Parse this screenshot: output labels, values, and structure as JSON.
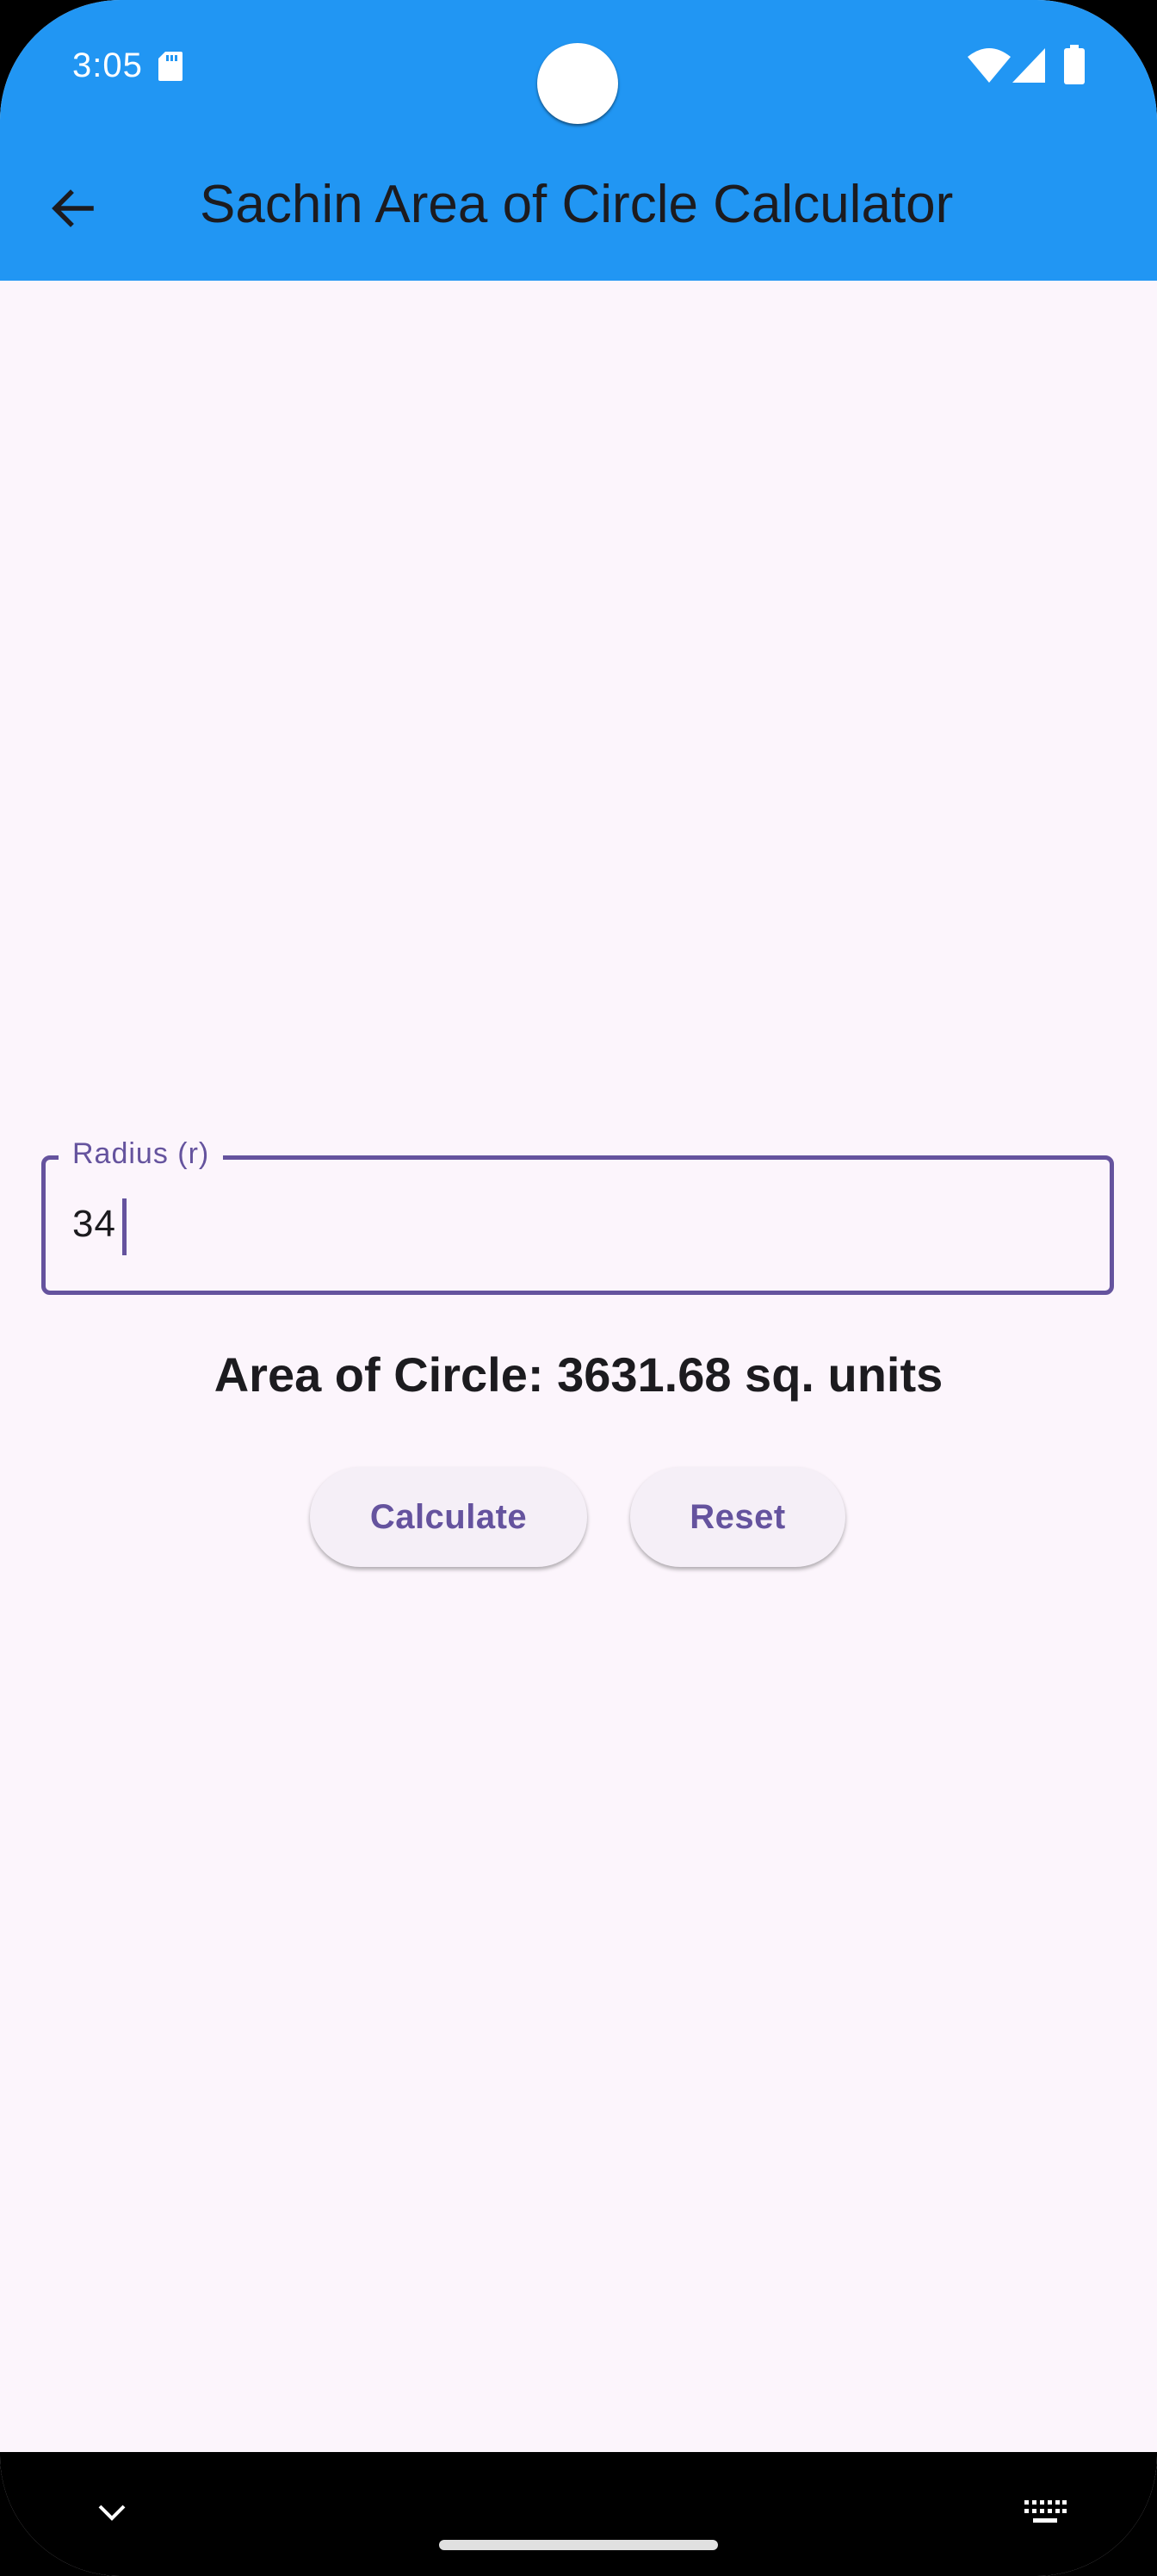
{
  "status_bar": {
    "time": "3:05",
    "icons": [
      "sd-card-icon",
      "wifi-icon",
      "signal-icon",
      "battery-icon"
    ]
  },
  "app_bar": {
    "title": "Sachin Area of Circle Calculator",
    "back_icon": "arrow-back-icon",
    "background_color": "#2196F3"
  },
  "form": {
    "radius_label": "Radius (r)",
    "radius_value": "34",
    "accent_color": "#65539E"
  },
  "result_text": "Area of Circle: 3631.68 sq. units",
  "buttons": {
    "calculate_label": "Calculate",
    "reset_label": "Reset"
  },
  "nav_bar": {
    "icons": [
      "chevron-down-icon",
      "keyboard-icon"
    ]
  }
}
